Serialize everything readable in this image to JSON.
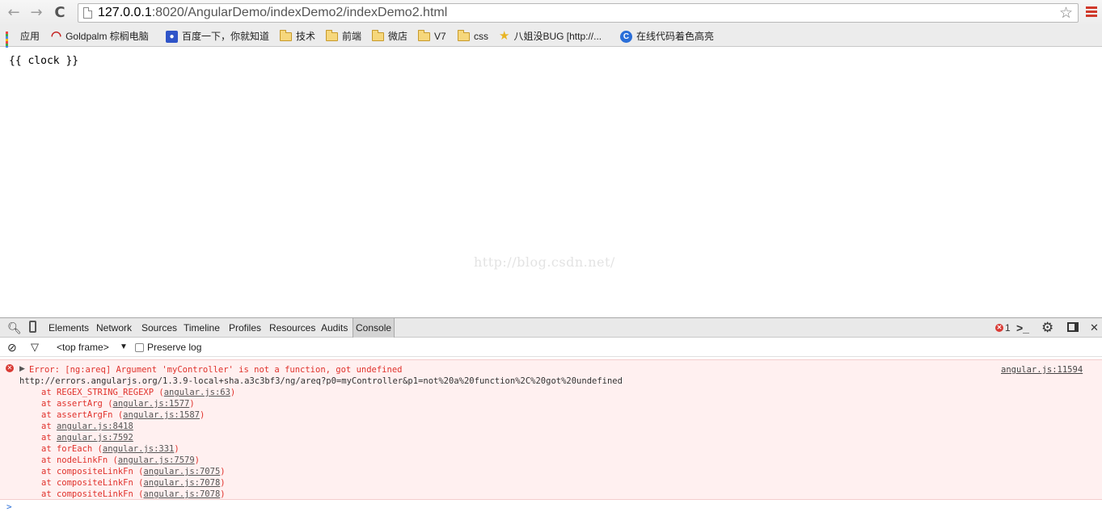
{
  "browser": {
    "back_icon": "←",
    "forward_icon": "→",
    "reload_icon": "C",
    "url_host": "127.0.0.1",
    "url_rest": ":8020/AngularDemo/indexDemo2/indexDemo2.html",
    "star_icon": "☆"
  },
  "bookmarks": [
    {
      "label": "应用",
      "icon": "apps-grid-icon"
    },
    {
      "label": "Goldpalm 棕榈电脑",
      "icon": "arc-icon"
    },
    {
      "label": "百度一下，你就知道",
      "icon": "paw-icon"
    },
    {
      "label": "技术",
      "icon": "folder-icon"
    },
    {
      "label": "前端",
      "icon": "folder-icon"
    },
    {
      "label": "微店",
      "icon": "folder-icon"
    },
    {
      "label": "V7",
      "icon": "folder-icon"
    },
    {
      "label": "css",
      "icon": "folder-icon"
    },
    {
      "label": "八姐没BUG [http://...",
      "icon": "star-icon"
    },
    {
      "label": "在线代码着色高亮",
      "icon": "c-icon"
    }
  ],
  "page": {
    "content": "{{ clock }}",
    "watermark": "http://blog.csdn.net/"
  },
  "devtools": {
    "tabs": [
      "Elements",
      "Network",
      "Sources",
      "Timeline",
      "Profiles",
      "Resources",
      "Audits",
      "Console"
    ],
    "active_tab": "Console",
    "error_count": "1",
    "frame_selector": "<top frame>",
    "preserve_log_label": "Preserve log",
    "console": {
      "error_message": "Error: [ng:areq] Argument 'myController' is not a function, got undefined",
      "error_url": "http://errors.angularjs.org/1.3.9-local+sha.a3c3bf3/ng/areq?p0=myController&p1=not%20a%20function%2C%20got%20undefined",
      "source_link": "angular.js:11594",
      "stack": [
        {
          "fn": "at REGEX_STRING_REGEXP",
          "loc": "angular.js:63"
        },
        {
          "fn": "at assertArg",
          "loc": "angular.js:1577"
        },
        {
          "fn": "at assertArgFn",
          "loc": "angular.js:1587"
        },
        {
          "fn": "at",
          "loc": "angular.js:8418",
          "bare": true
        },
        {
          "fn": "at",
          "loc": "angular.js:7592",
          "bare": true
        },
        {
          "fn": "at forEach",
          "loc": "angular.js:331"
        },
        {
          "fn": "at nodeLinkFn",
          "loc": "angular.js:7579"
        },
        {
          "fn": "at compositeLinkFn",
          "loc": "angular.js:7075"
        },
        {
          "fn": "at compositeLinkFn",
          "loc": "angular.js:7078"
        },
        {
          "fn": "at compositeLinkFn",
          "loc": "angular.js:7078"
        }
      ],
      "prompt": ">"
    }
  }
}
